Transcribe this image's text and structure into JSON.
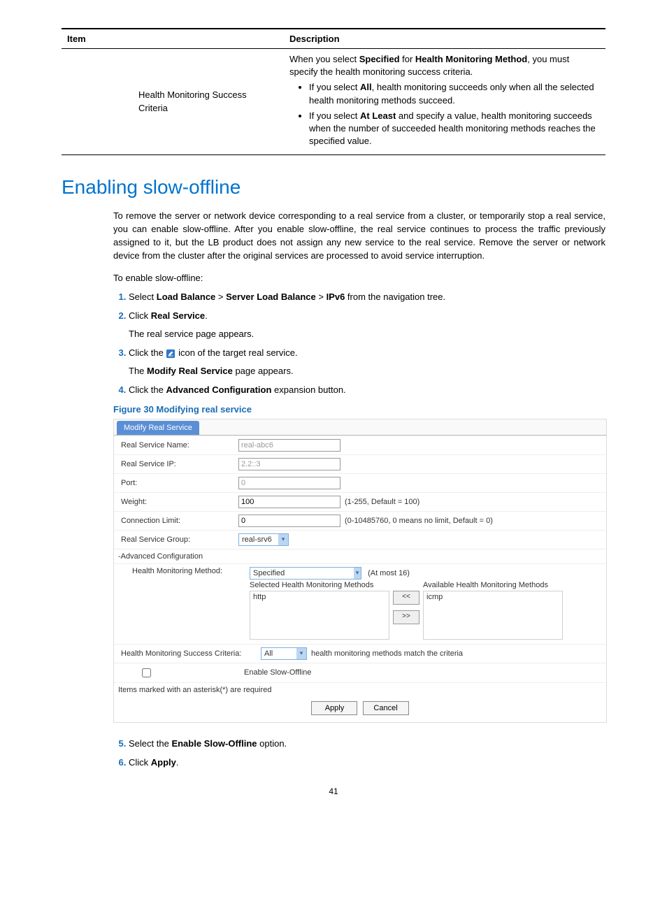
{
  "table": {
    "header_item": "Item",
    "header_desc": "Description",
    "row1_item": "Health Monitoring Success Criteria",
    "row1_desc_intro_1": "When you select ",
    "row1_desc_bold_1": "Specified",
    "row1_desc_intro_2": " for ",
    "row1_desc_bold_2": "Health Monitoring Method",
    "row1_desc_intro_3": ", you must specify the health monitoring success criteria.",
    "row1_b1_a": "If you select ",
    "row1_b1_bold": "All",
    "row1_b1_b": ", health monitoring succeeds only when all the selected health monitoring methods succeed.",
    "row1_b2_a": "If you select ",
    "row1_b2_bold": "At Least",
    "row1_b2_b": " and specify a value, health monitoring succeeds when the number of succeeded health monitoring methods reaches the specified value."
  },
  "heading": "Enabling slow-offline",
  "para1": "To remove the server or network device corresponding to a real service from a cluster, or temporarily stop a real service, you can enable slow-offline. After you enable slow-offline, the real service continues to process the traffic previously assigned to it, but the LB product does not assign any new service to the real service. Remove the server or network device from the cluster after the original services are processed to avoid service interruption.",
  "intro": "To enable slow-offline:",
  "step1_a": "Select ",
  "step1_b1": "Load Balance",
  "step1_gt1": " > ",
  "step1_b2": "Server Load Balance",
  "step1_gt2": " > ",
  "step1_b3": "IPv6",
  "step1_c": " from the navigation tree.",
  "step2_a": "Click ",
  "step2_b": "Real Service",
  "step2_c": ".",
  "step2_sub": "The real service page appears.",
  "step3_a": "Click the ",
  "step3_b": " icon of the target real service.",
  "step3_sub_a": "The ",
  "step3_sub_b": "Modify Real Service",
  "step3_sub_c": " page appears.",
  "step4_a": "Click the ",
  "step4_b": "Advanced Configuration",
  "step4_c": " expansion button.",
  "figure_caption": "Figure 30 Modifying real service",
  "form": {
    "tab": "Modify Real Service",
    "l_name": "Real Service Name:",
    "v_name": "real-abc6",
    "l_ip": "Real Service IP:",
    "v_ip": "2.2::3",
    "l_port": "Port:",
    "v_port": "0",
    "l_weight": "Weight:",
    "v_weight": "100",
    "h_weight": "(1-255, Default = 100)",
    "l_conn": "Connection Limit:",
    "v_conn": "0",
    "h_conn": "(0-10485760, 0 means no limit, Default = 0)",
    "l_group": "Real Service Group:",
    "v_group": "real-srv6",
    "adv": "-Advanced Configuration",
    "l_hmm": "Health Monitoring Method:",
    "v_hmm": "Specified",
    "h_hmm": "(At most 16)",
    "sel_title": "Selected Health Monitoring Methods",
    "sel_item": "http",
    "avail_title": "Available Health Monitoring Methods",
    "avail_item": "icmp",
    "btn_left": "<<",
    "btn_right": ">>",
    "l_crit": "Health Monitoring Success Criteria:",
    "v_crit": "All",
    "h_crit": "health monitoring methods match the criteria",
    "l_slow": "Enable Slow-Offline",
    "note": "Items marked with an asterisk(*) are required",
    "apply": "Apply",
    "cancel": "Cancel"
  },
  "step5_a": "Select the ",
  "step5_b": "Enable Slow-Offline",
  "step5_c": " option.",
  "step6_a": "Click ",
  "step6_b": "Apply",
  "step6_c": ".",
  "page_number": "41"
}
